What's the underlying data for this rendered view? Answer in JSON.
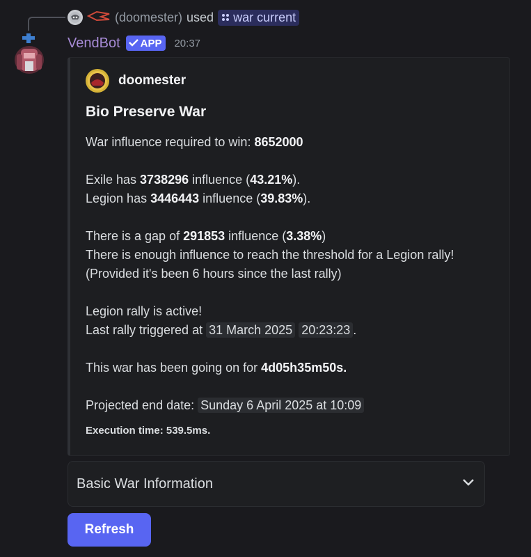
{
  "reply": {
    "user": "(doomester)",
    "used": "used",
    "command": "war current"
  },
  "header": {
    "bot_name": "VendBot",
    "badge": "APP",
    "time": "20:37"
  },
  "embed": {
    "author": "doomester",
    "title": "Bio Preserve War",
    "line1_prefix": "War influence required to win: ",
    "line1_value": "8652000",
    "exile_prefix": "Exile has ",
    "exile_value": "3738296",
    "exile_mid": " influence (",
    "exile_pct": "43.21%",
    "exile_end": ").",
    "legion_prefix": "Legion has ",
    "legion_value": "3446443",
    "legion_mid": " influence (",
    "legion_pct": "39.83%",
    "legion_end": ").",
    "gap_prefix": "There is a gap of ",
    "gap_value": "291853",
    "gap_mid": " influence (",
    "gap_pct": "3.38%",
    "gap_end": ")",
    "enough": "There is enough influence to reach the threshold for a Legion rally!",
    "provided": "(Provided it's been 6 hours since the last rally)",
    "rally_active": "Legion rally is active!",
    "last_rally_prefix": "Last rally triggered at ",
    "last_rally_date": "31 March 2025",
    "last_rally_time": "20:23:23",
    "last_rally_end": ".",
    "duration_prefix": "This war has been going on for ",
    "duration_value": "4d05h35m50s.",
    "projected_prefix": "Projected end date: ",
    "projected_value": "Sunday 6 April 2025 at 10:09",
    "execution": "Execution time: 539.5ms."
  },
  "select": {
    "label": "Basic War Information"
  },
  "button": {
    "label": "Refresh"
  },
  "colors": {
    "background": "#1a1a1e",
    "accent": "#5865f2",
    "bot_name": "#a78bd6"
  },
  "icons": {
    "command": "slash-command-icon",
    "badge": "checkmark-icon",
    "select": "chevron-down-icon"
  }
}
